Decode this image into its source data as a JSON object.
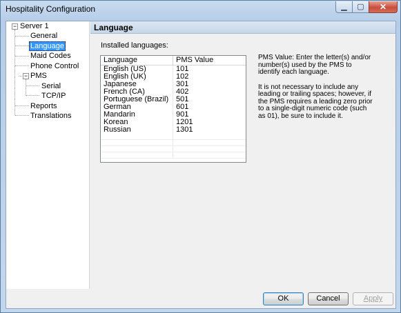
{
  "window": {
    "title": "Hospitality Configuration",
    "controls": [
      "minimize-icon",
      "maximize-icon",
      "close-icon"
    ]
  },
  "tree": {
    "expander_open": "−",
    "items": [
      {
        "label": "Server 1"
      },
      {
        "label": "General"
      },
      {
        "label": "Language",
        "selected": true
      },
      {
        "label": "Maid Codes"
      },
      {
        "label": "Phone Control"
      },
      {
        "label": "PMS"
      },
      {
        "label": "Serial"
      },
      {
        "label": "TCP/IP"
      },
      {
        "label": "Reports"
      },
      {
        "label": "Translations"
      }
    ]
  },
  "panel": {
    "title": "Language",
    "installed_label": "Installed languages:",
    "table": {
      "columns": [
        "Language",
        "PMS Value"
      ],
      "rows": [
        [
          "English (US)",
          "101"
        ],
        [
          "English (UK)",
          "102"
        ],
        [
          "Japanese",
          "301"
        ],
        [
          "French (CA)",
          "402"
        ],
        [
          "Portuguese (Brazil)",
          "501"
        ],
        [
          "German",
          "601"
        ],
        [
          "Mandarin",
          "901"
        ],
        [
          "Korean",
          "1201"
        ],
        [
          "Russian",
          "1301"
        ]
      ]
    },
    "help": [
      "PMS Value:  Enter the letter(s) and/or number(s) used by the PMS to identify each language.",
      "It is not necessary to include any leading or trailing spaces; however, if the PMS requires a leading zero prior to a single-digit numeric code (such as 01), be sure to include it."
    ]
  },
  "buttons": {
    "ok": "OK",
    "cancel": "Cancel",
    "apply": "Apply"
  }
}
